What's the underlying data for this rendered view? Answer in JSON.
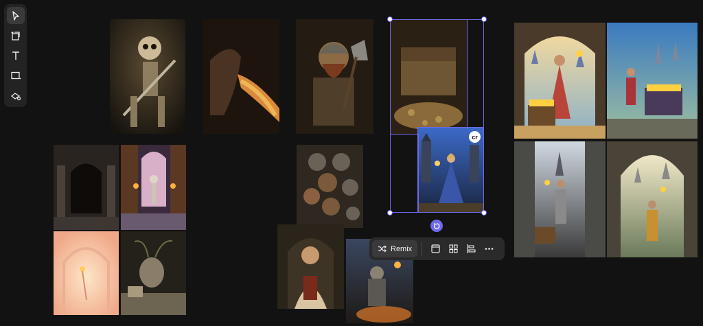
{
  "toolbar": {
    "tools": [
      {
        "name": "select-tool",
        "icon": "cursor-arrow-icon",
        "active": true
      },
      {
        "name": "generate-image-tool",
        "icon": "image-plus-icon"
      },
      {
        "name": "text-tool",
        "icon": "text-T-icon"
      },
      {
        "name": "shape-tool",
        "icon": "rectangle-icon"
      },
      {
        "name": "assets-tool",
        "icon": "stack-settings-icon"
      }
    ]
  },
  "selection": {
    "badge": "cr"
  },
  "floating_toolbar": {
    "remix_label": "Remix",
    "icons": [
      "remix-shuffle-icon",
      "panel-icon",
      "arrange-grid-icon",
      "align-left-icon",
      "more-dots-icon"
    ]
  },
  "canvas_images": [
    "skeleton-warrior",
    "dragon-fire",
    "dwarf-axe",
    "treasure-chest-cave",
    "knight-woman-castle",
    "dungeon-corridor",
    "skeleton-alley",
    "coin-wall",
    "peach-arch-skeleton",
    "still-life-pottery",
    "peasant-portrait",
    "armored-warrior-fire",
    "princess-treasure",
    "knight-treasure-chest",
    "knight-castle-path",
    "knight-gate-sunset"
  ],
  "colors": {
    "accent": "#6f6ae8",
    "background": "#121212",
    "panel": "#232323"
  }
}
